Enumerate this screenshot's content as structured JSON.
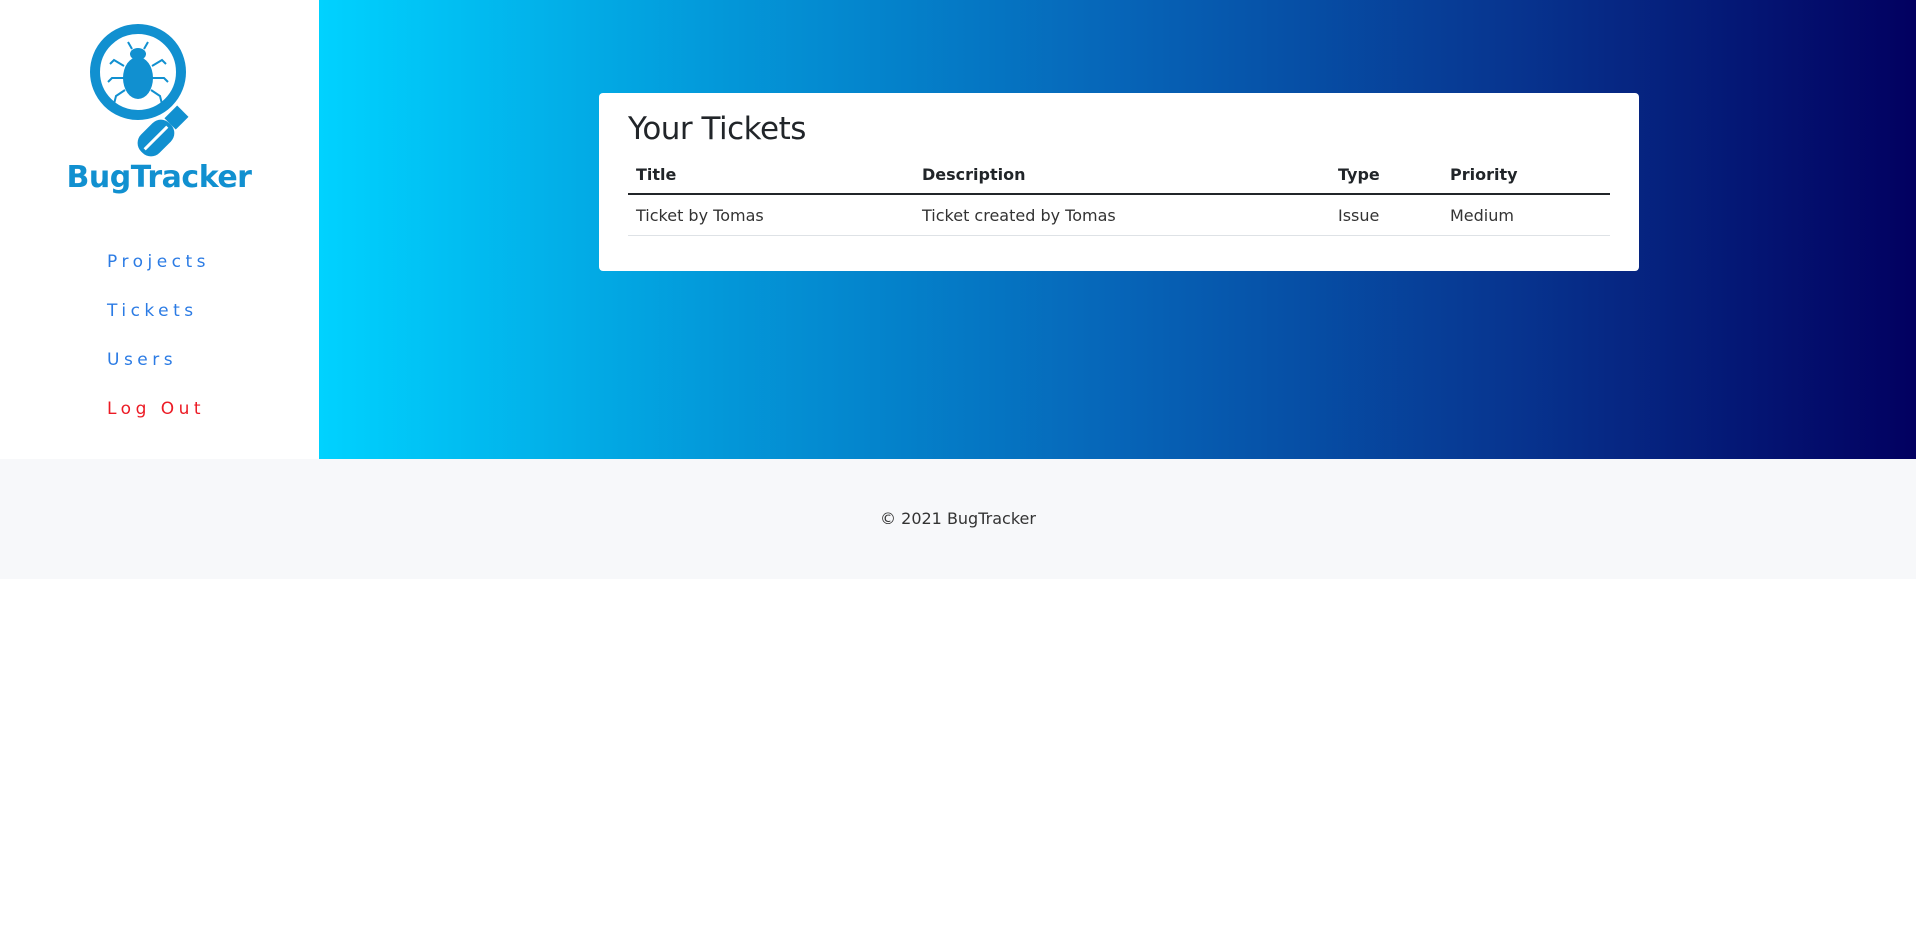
{
  "brand": {
    "name": "BugTracker",
    "color": "#1190d0"
  },
  "nav": {
    "items": [
      {
        "label": "Projects"
      },
      {
        "label": "Tickets"
      },
      {
        "label": "Users"
      },
      {
        "label": "Log Out"
      }
    ]
  },
  "card": {
    "title": "Your Tickets",
    "columns": [
      "Title",
      "Description",
      "Type",
      "Priority"
    ],
    "rows": [
      [
        "Ticket by Tomas",
        "Ticket created by Tomas",
        "Issue",
        "Medium"
      ]
    ]
  },
  "footer": {
    "text": "© 2021 BugTracker"
  },
  "colors": {
    "gradient_start": "#00d2ff",
    "gradient_end": "#020060",
    "nav_link": "#2b7be4",
    "logout": "#ec1a24"
  }
}
